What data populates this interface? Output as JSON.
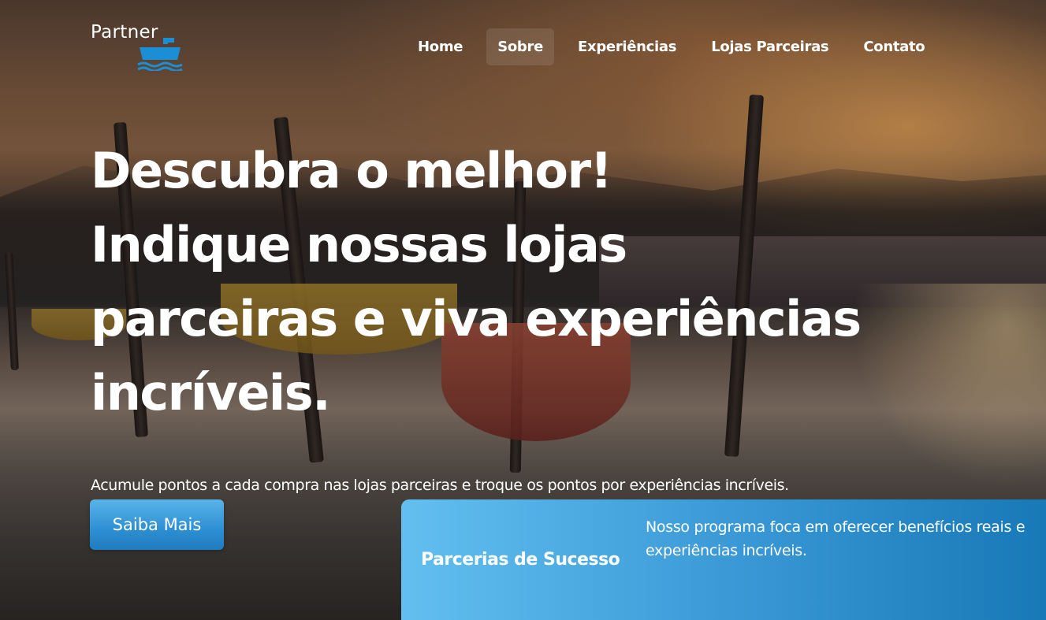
{
  "brand": {
    "logo_text": "Partner",
    "icon": "ship-icon",
    "icon_color": "#1a8fd6"
  },
  "nav": {
    "items": [
      {
        "label": "Home",
        "active": false
      },
      {
        "label": "Sobre",
        "active": true
      },
      {
        "label": "Experiências",
        "active": false
      },
      {
        "label": "Lojas Parceiras",
        "active": false
      },
      {
        "label": "Contato",
        "active": false
      }
    ]
  },
  "hero": {
    "headline_lines": [
      "Descubra o melhor!",
      "Indique nossas lojas",
      "parceiras e viva experiências",
      "incríveis."
    ],
    "subtext": "Acumule pontos a cada compra nas lojas parceiras e troque os pontos por experiências incríveis.",
    "cta_label": "Saiba Mais"
  },
  "card": {
    "title": "Parcerias de Sucesso",
    "text": "Nosso programa foca em oferecer benefícios reais e experiências incríveis."
  },
  "colors": {
    "accent": "#2d8fd3",
    "card_gradient_start": "#63bff0",
    "card_gradient_end": "#1677b6",
    "text": "#ffffff"
  }
}
